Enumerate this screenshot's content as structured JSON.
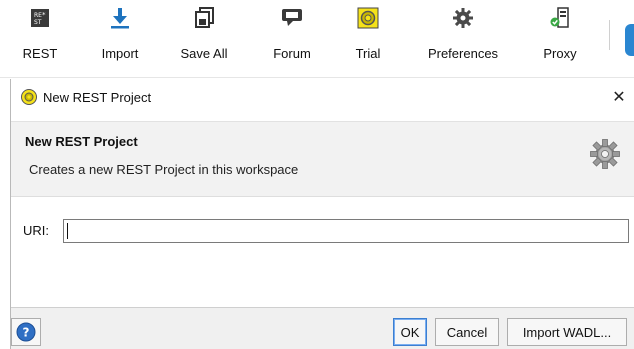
{
  "toolbar": {
    "items": [
      {
        "label": "REST",
        "icon": "rest-icon"
      },
      {
        "label": "Import",
        "icon": "import-icon"
      },
      {
        "label": "Save All",
        "icon": "save-all-icon"
      },
      {
        "label": "Forum",
        "icon": "forum-icon"
      },
      {
        "label": "Trial",
        "icon": "trial-icon"
      },
      {
        "label": "Preferences",
        "icon": "gear-icon"
      },
      {
        "label": "Proxy",
        "icon": "proxy-icon"
      }
    ],
    "rest_icon_text": "RE\nST"
  },
  "dialog": {
    "title": "New REST Project",
    "close_glyph": "✕",
    "banner": {
      "title": "New REST Project",
      "description": "Creates a new REST Project in this workspace"
    },
    "uri": {
      "label": "URI:",
      "value": "",
      "placeholder": ""
    },
    "buttons": {
      "help": "?",
      "ok": "OK",
      "cancel": "Cancel",
      "import_wadl": "Import WADL..."
    }
  },
  "colors": {
    "accent": "#1e73be",
    "trial_yellow": "#f5e21a",
    "gear_gray": "#8a8a8a"
  }
}
